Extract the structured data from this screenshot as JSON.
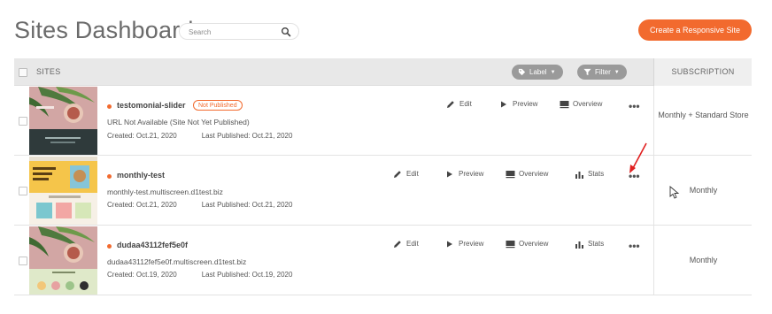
{
  "header": {
    "title": "Sites Dashboard",
    "search_placeholder": "Search",
    "create_button": "Create a Responsive Site"
  },
  "table": {
    "sites_header": "SITES",
    "label_filter": "Label",
    "filter_button": "Filter",
    "subscription_header": "SUBSCRIPTION"
  },
  "rows": [
    {
      "name": "testomonial-slider",
      "badge": "Not Published",
      "url": "URL Not Available (Site Not Yet Published)",
      "created": "Created: Oct.21, 2020",
      "published": "Last Published: Oct.21, 2020",
      "actions": {
        "edit": "Edit",
        "preview": "Preview",
        "overview": "Overview"
      },
      "more": "•••",
      "subscription": "Monthly + Standard Store"
    },
    {
      "name": "monthly-test",
      "url": "monthly-test.multiscreen.d1test.biz",
      "created": "Created: Oct.21, 2020",
      "published": "Last Published: Oct.21, 2020",
      "actions": {
        "edit": "Edit",
        "preview": "Preview",
        "overview": "Overview",
        "stats": "Stats"
      },
      "more": "•••",
      "subscription": "Monthly"
    },
    {
      "name": "dudaa43112fef5e0f",
      "url": "dudaa43112fef5e0f.multiscreen.d1test.biz",
      "created": "Created: Oct.19, 2020",
      "published": "Last Published: Oct.19, 2020",
      "actions": {
        "edit": "Edit",
        "preview": "Preview",
        "overview": "Overview",
        "stats": "Stats"
      },
      "more": "•••",
      "subscription": "Monthly"
    }
  ],
  "colors": {
    "accent": "#f26a2e",
    "header_bg": "#e8e8e8",
    "pill_bg": "#9a9a9a",
    "annotation_arrow": "#e02020"
  }
}
